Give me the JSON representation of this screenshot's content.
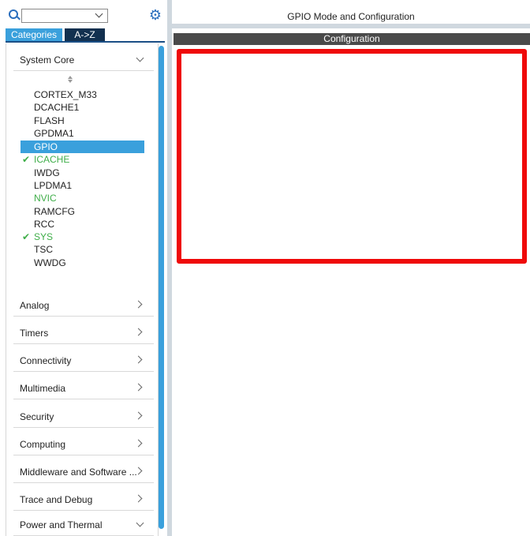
{
  "left_panel": {
    "tabs": {
      "categories": "Categories",
      "az": "A->Z"
    },
    "categories": [
      {
        "label": "System Core",
        "expanded": true
      },
      {
        "label": "Analog"
      },
      {
        "label": "Timers"
      },
      {
        "label": "Connectivity"
      },
      {
        "label": "Multimedia"
      },
      {
        "label": "Security"
      },
      {
        "label": "Computing"
      },
      {
        "label": "Middleware and Software ..."
      },
      {
        "label": "Trace and Debug"
      },
      {
        "label": "Power and Thermal",
        "expanded": true
      }
    ],
    "system_core_items": [
      {
        "label": "CORTEX_M33"
      },
      {
        "label": "DCACHE1"
      },
      {
        "label": "FLASH"
      },
      {
        "label": "GPDMA1"
      },
      {
        "label": "GPIO",
        "selected": true
      },
      {
        "label": "ICACHE",
        "status": "configured"
      },
      {
        "label": "IWDG"
      },
      {
        "label": "LPDMA1"
      },
      {
        "label": "NVIC",
        "status": "enabled"
      },
      {
        "label": "RAMCFG"
      },
      {
        "label": "RCC"
      },
      {
        "label": "SYS",
        "status": "configured"
      },
      {
        "label": "TSC"
      },
      {
        "label": "WWDG"
      }
    ],
    "icons": {
      "search": "search-icon",
      "settings": "gear-icon",
      "check": "check-icon"
    }
  },
  "right_panel": {
    "title": "GPIO Mode and Configuration",
    "configuration_label": "Configuration"
  },
  "colors": {
    "accent": "#3aa0dc",
    "dark_tab": "#12304f",
    "check_green": "#3fae49",
    "highlight_red": "#ef0a0a",
    "config_bar": "#4a4a4a"
  }
}
